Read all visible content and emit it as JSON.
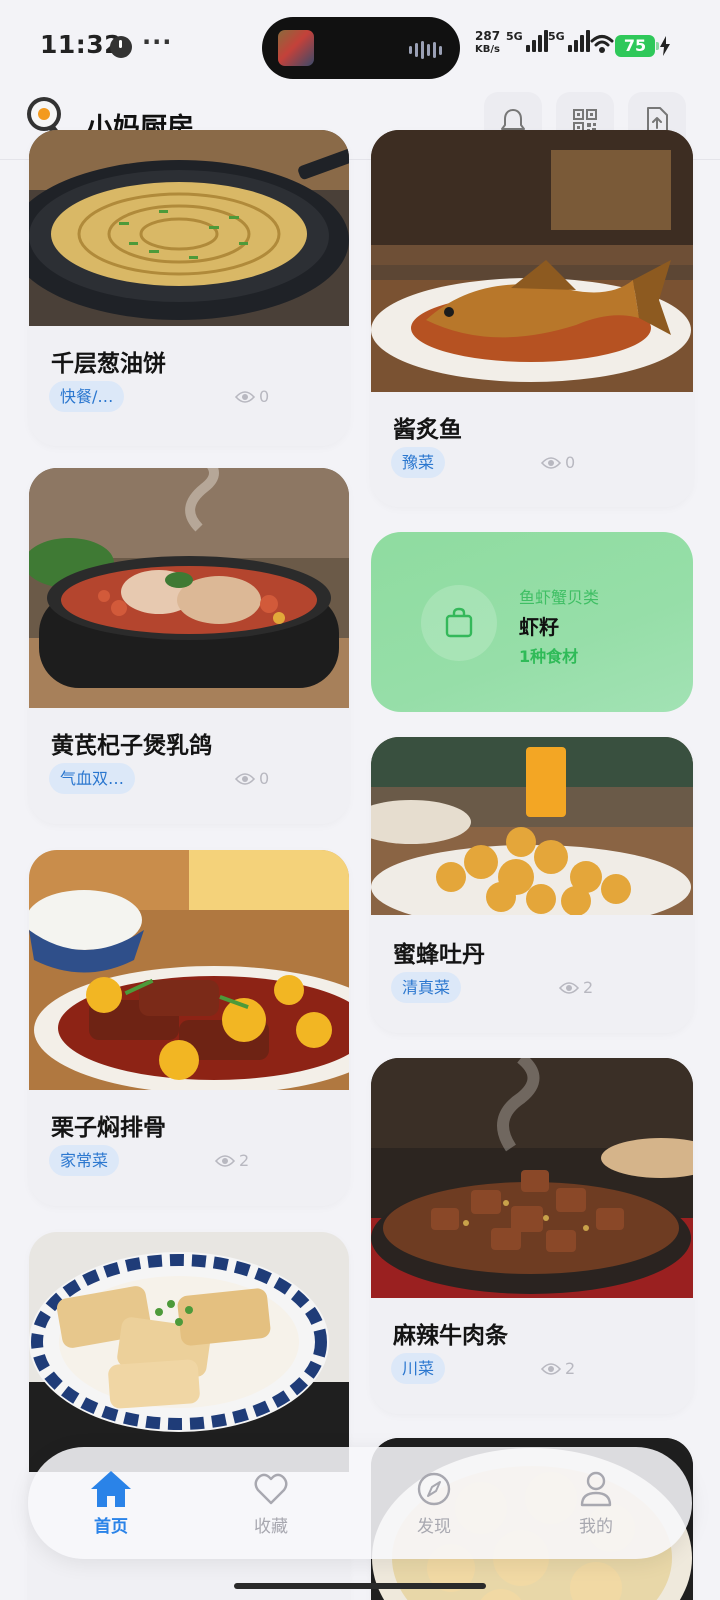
{
  "status_bar": {
    "time": "11:32",
    "more": "···",
    "net_speed_value": "287",
    "net_speed_unit": "KB/s",
    "sim1_tag": "5G",
    "sim2_tag": "5G",
    "battery": "75"
  },
  "header": {
    "title": "小妈厨房"
  },
  "recipes": [
    {
      "name": "千层葱油饼",
      "tag": "快餐/…",
      "views": "0"
    },
    {
      "name": "黄芪杞子煲乳鸽",
      "tag": "气血双…",
      "views": "0"
    },
    {
      "name": "栗子焖排骨",
      "tag": "家常菜",
      "views": "2"
    },
    {
      "name": "酱炙鱼",
      "tag": "豫菜",
      "views": "0"
    },
    {
      "name": "蜜蜂吐丹",
      "tag": "清真菜",
      "views": "2"
    },
    {
      "name": "麻辣牛肉条",
      "tag": "川菜",
      "views": "2"
    }
  ],
  "ingredient_card": {
    "category": "鱼虾蟹贝类",
    "name": "虾籽",
    "count": "1种食材",
    "accent": "#2fbb58"
  },
  "tabs": [
    {
      "label": "首页",
      "active": true
    },
    {
      "label": "收藏",
      "active": false
    },
    {
      "label": "发现",
      "active": false
    },
    {
      "label": "我的",
      "active": false
    }
  ],
  "colors": {
    "background": "#f3f3f7",
    "tag_bg": "#dce8f8",
    "tag_text": "#2b77cf",
    "active_tab": "#2a83e8",
    "ingredient_card_bg": "#96dea8"
  }
}
